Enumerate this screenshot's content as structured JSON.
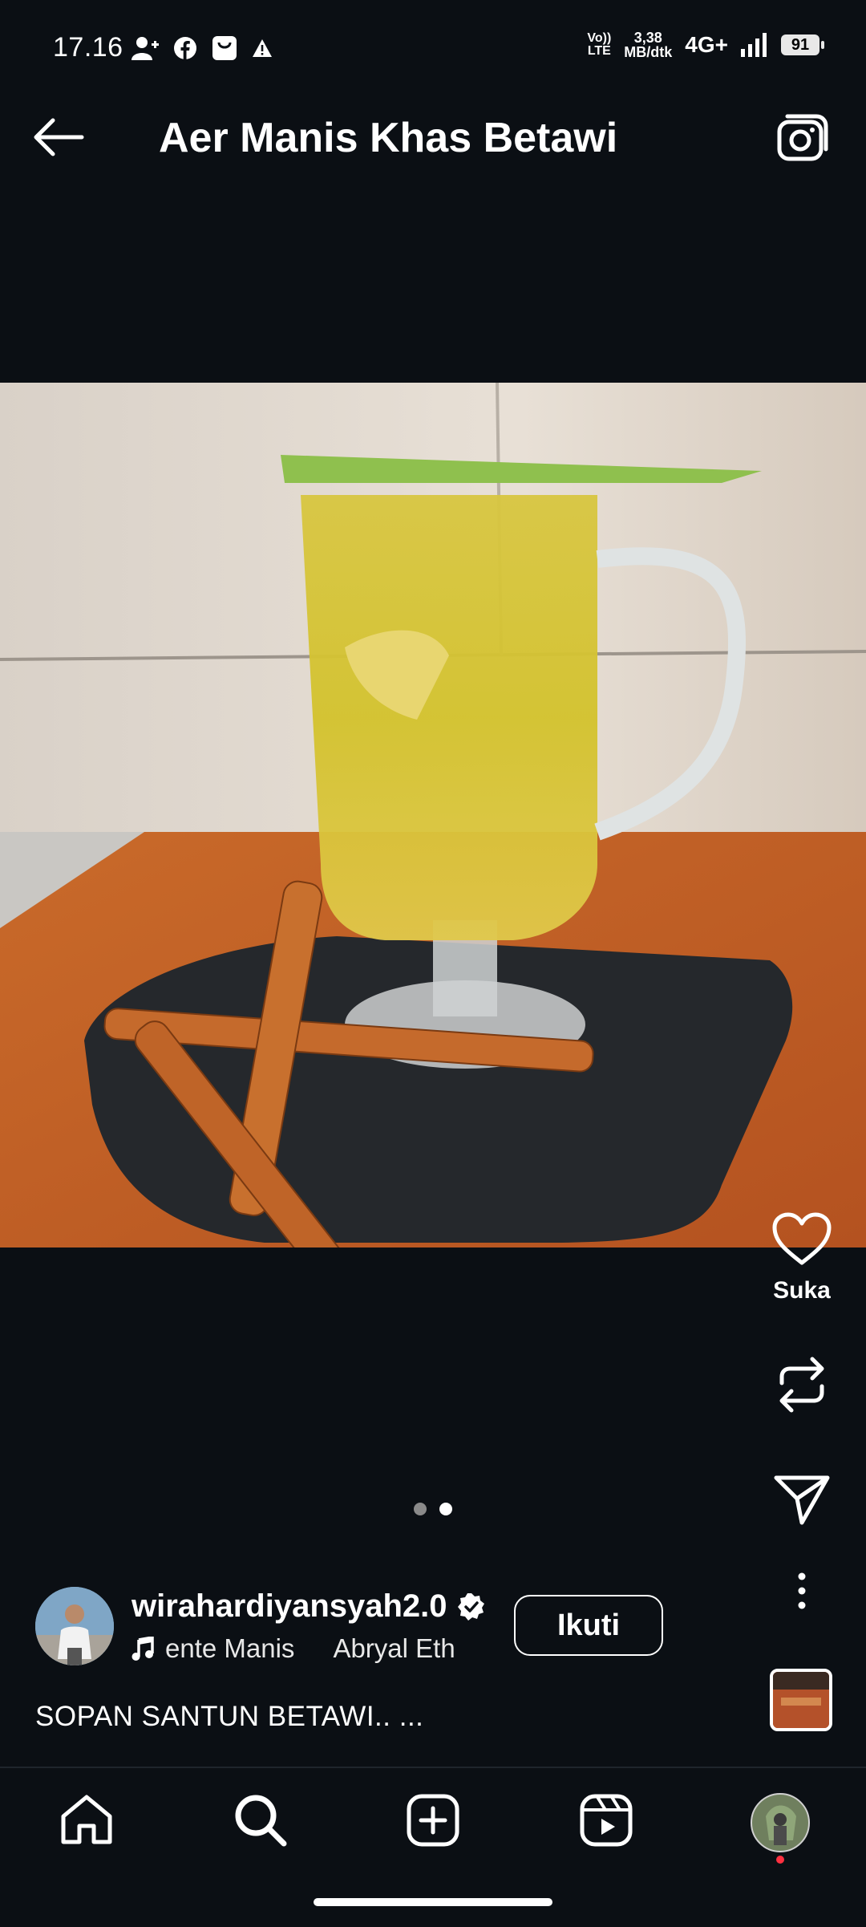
{
  "status_bar": {
    "time": "17.16",
    "volte_line1": "Vo))",
    "volte_line2": "LTE",
    "speed_value": "3,38",
    "speed_unit": "MB/dtk",
    "network": "4G+",
    "battery": "91",
    "icons": [
      "person-add-icon",
      "facebook-icon",
      "shopping-bag-icon",
      "warning-icon",
      "signal-icon"
    ]
  },
  "header": {
    "title": "Aer Manis Khas Betawi",
    "back_icon": "arrow-left-icon",
    "camera_icon": "camera-icon"
  },
  "post": {
    "image_description_icon": "drink-photo",
    "carousel_count": 2,
    "carousel_active": 2,
    "actions": {
      "like_label": "Suka",
      "like_icon": "heart-icon",
      "repost_icon": "repost-icon",
      "share_icon": "send-icon",
      "more_icon": "more-vertical-icon"
    },
    "author": {
      "username": "wirahardiyansyah2.0",
      "verified_icon": "verified-badge-icon",
      "music_icon": "music-note-icon",
      "music_title": "ente Manis",
      "music_artist": "Abryal Eth",
      "follow_label": "Ikuti"
    },
    "caption": "SOPAN SANTUN BETAWI.. ..."
  },
  "nav": {
    "items": [
      "home-icon",
      "search-icon",
      "create-icon",
      "reels-icon",
      "profile-avatar"
    ]
  },
  "colors": {
    "background": "#0b0f14",
    "text": "#ffffff",
    "accent_dot": "#ff3040"
  }
}
